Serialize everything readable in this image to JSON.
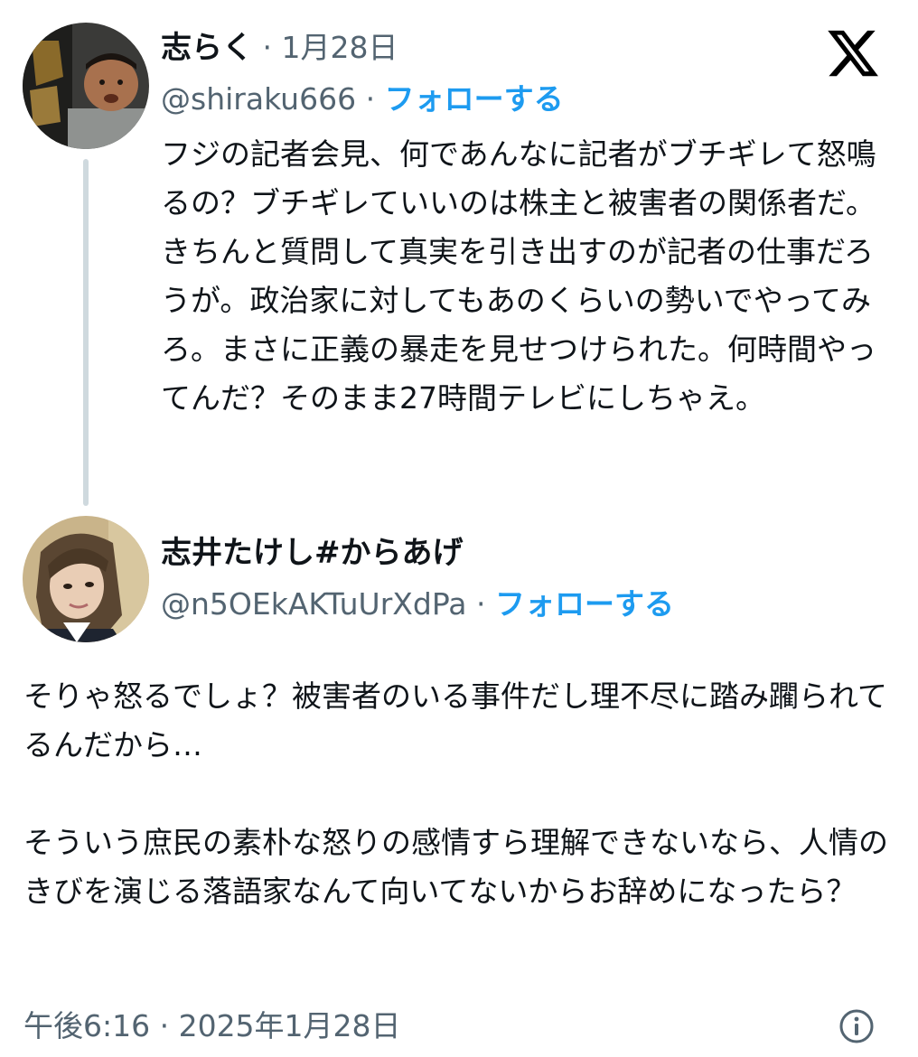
{
  "quoted_tweet": {
    "display_name": "志らく",
    "separator": "·",
    "date": "1月28日",
    "handle": "@shiraku666",
    "follow_label": "フォローする",
    "text": "フジの記者会見、何であんなに記者がブチギレて怒鳴るの？ブチギレていいのは株主と被害者の関係者だ。きちんと質問して真実を引き出すのが記者の仕事だろうが。政治家に対してもあのくらいの勢いでやってみろ。まさに正義の暴走を見せつけられた。何時間やってんだ？そのまま27時間テレビにしちゃえ。"
  },
  "reply_tweet": {
    "display_name": "志井たけし#からあげ",
    "separator": "·",
    "handle": "@n5OEkAKTuUrXdPa",
    "follow_label": "フォローする",
    "text_paragraph_1": "そりゃ怒るでしょ？被害者のいる事件だし理不尽に踏み躙られてるんだから…",
    "text_paragraph_2": "そういう庶民の素朴な怒りの感情すら理解できないなら、人情のきびを演じる落語家なんて向いてないからお辞めになったら？",
    "timestamp": "午後6:16 · 2025年1月28日"
  },
  "icons": {
    "brand_logo": "x-logo-icon",
    "info": "info-icon"
  },
  "colors": {
    "follow_link": "#1d9bf0",
    "secondary_text": "#536471",
    "primary_text": "#0f1419",
    "thread_line": "#cfd9de"
  }
}
